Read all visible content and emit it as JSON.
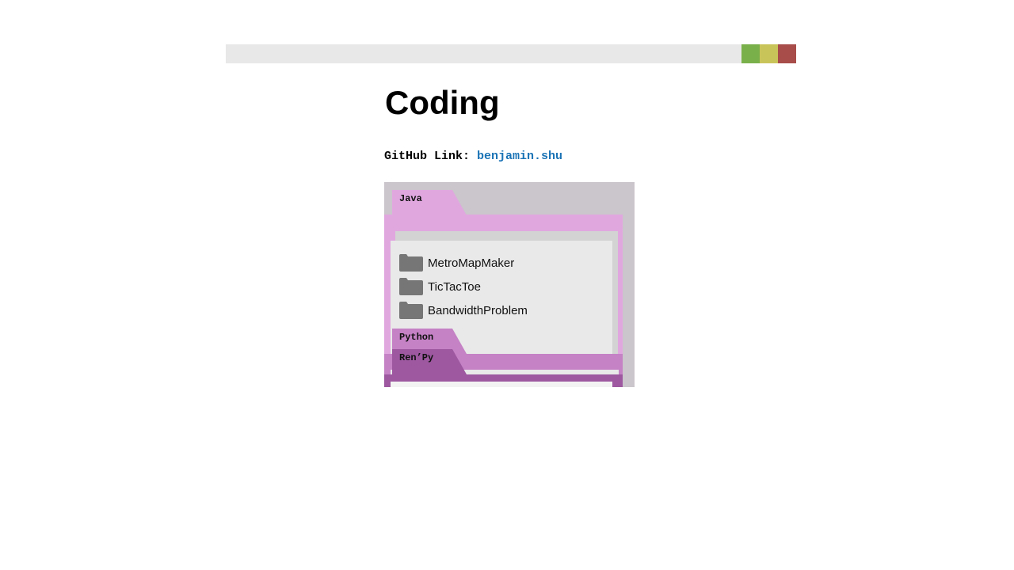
{
  "window": {
    "buttons": [
      {
        "name": "green",
        "color": "#7ab04a"
      },
      {
        "name": "yellow",
        "color": "#c9c45a"
      },
      {
        "name": "red",
        "color": "#a84d4a"
      }
    ]
  },
  "page": {
    "title": "Coding",
    "github_label": "GitHub Link: ",
    "github_link_text": "benjamin.shu"
  },
  "folders": [
    {
      "tab_label": "Java",
      "color": "#e0a7df",
      "items": [
        "MetroMapMaker",
        "TicTacToe",
        "BandwidthProblem"
      ]
    },
    {
      "tab_label": "Python",
      "color": "#c582c5",
      "items": []
    },
    {
      "tab_label": "Ren’Py",
      "color": "#9d58a0",
      "items": []
    }
  ],
  "icons": {
    "file_item": "folder-icon"
  }
}
